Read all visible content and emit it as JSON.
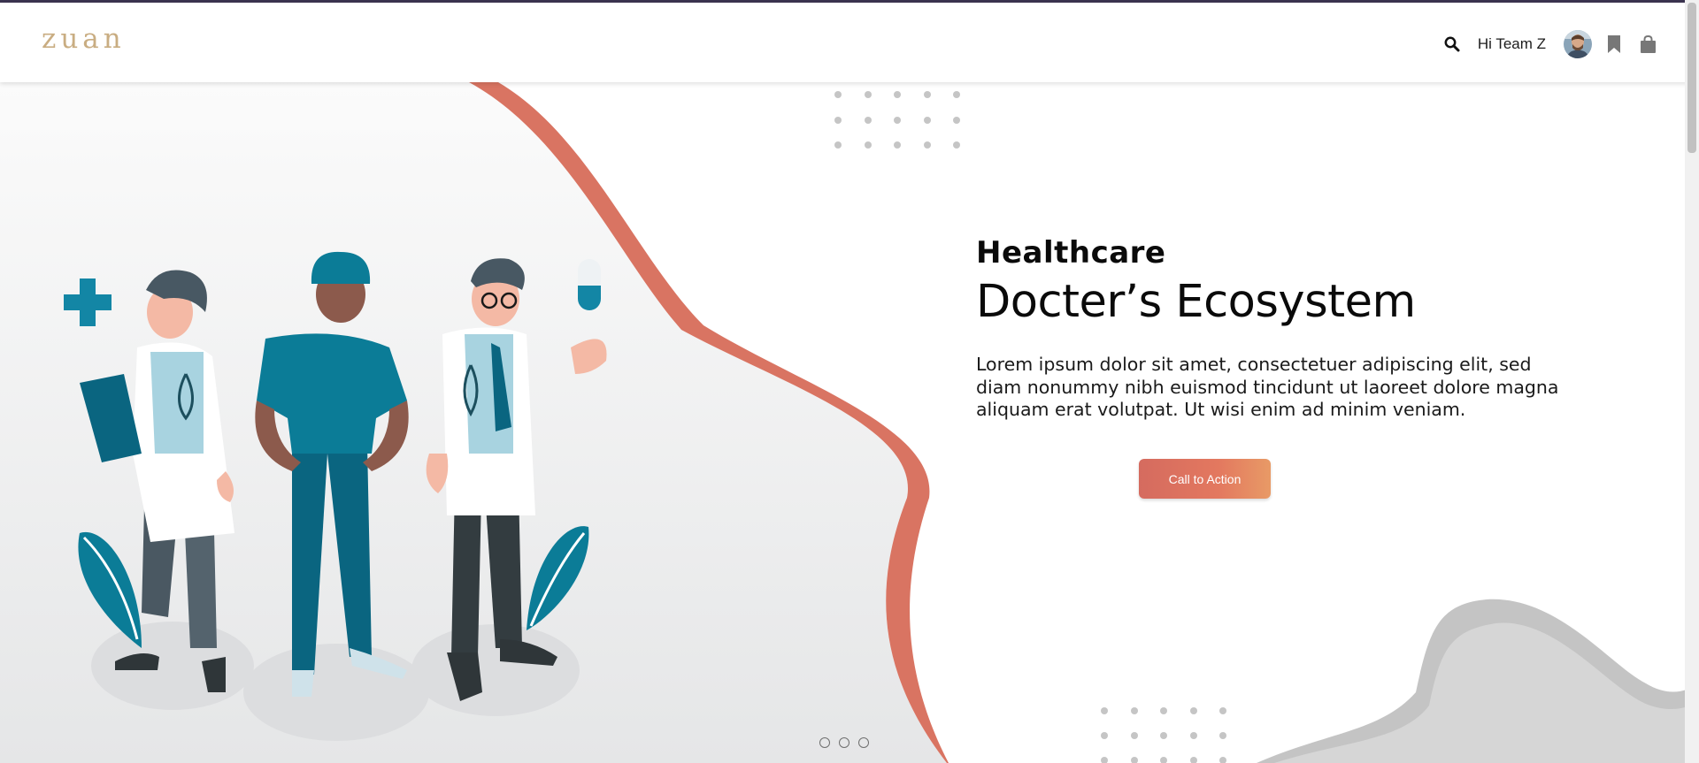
{
  "header": {
    "logo": "zuan",
    "greeting": "Hi Team Z",
    "icons": [
      "search-icon",
      "avatar",
      "bookmark-icon",
      "bag-icon"
    ]
  },
  "hero": {
    "eyebrow": "Healthcare",
    "headline": "Docter’s Ecosystem",
    "lead": "Lorem ipsum dolor sit amet, consectetuer adipiscing elit, sed diam nonummy nibh euismod tincidunt ut laoreet dolore magna aliquam erat volutpat. Ut wisi enim ad minim veniam.",
    "cta_label": "Call to Action"
  },
  "carousel": {
    "slide_count": 3,
    "active_index": 0
  },
  "colors": {
    "accent": "#d56b5f",
    "logo": "#c9ad82",
    "teal": "#0b7c97",
    "dark_teal": "#0a6580",
    "text": "#0a0a0a"
  }
}
